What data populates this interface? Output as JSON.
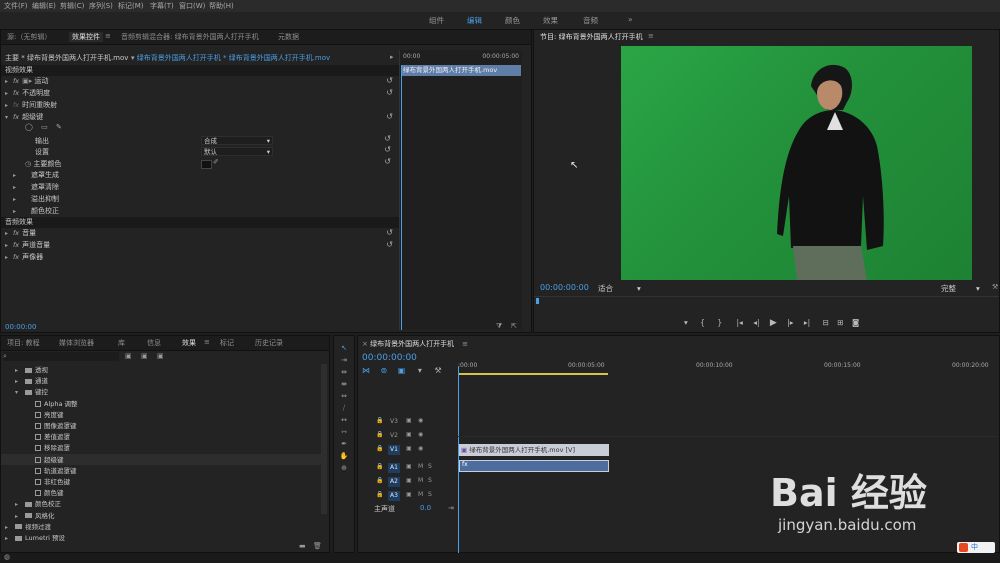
{
  "menubar": [
    "文件(F)",
    "编辑(E)",
    "剪辑(C)",
    "序列(S)",
    "标记(M)",
    "字幕(T)",
    "窗口(W)",
    "帮助(H)"
  ],
  "workspaces": [
    "组件",
    "编辑",
    "颜色",
    "效果",
    "音频",
    "»"
  ],
  "effect_controls": {
    "tabs": [
      "源:（无剪辑）",
      "效果控件",
      "≡",
      "音频剪辑混合器: 绿布背景外国两人打开手机",
      "元数据"
    ],
    "master_label": "主要 * 绿布背景外国两人打开手机.mov",
    "clip_label": "绿布背景外国两人打开手机 * 绿布背景外国两人打开手机.mov",
    "tl_start": "00:00",
    "tl_end": "00:00:05:00",
    "tl_clip": "绿布背景外国两人打开手机.mov",
    "sec_video": "视频效果",
    "rows": [
      "运动",
      "不透明度",
      "时间重映射",
      "超级键"
    ],
    "output_label": "输出",
    "output_value": "合成",
    "settings_label": "设置",
    "settings_value": "默认",
    "key_color_label": "主要颜色",
    "sub_rows": [
      "遮罩生成",
      "遮罩清除",
      "溢出抑制",
      "颜色校正"
    ],
    "sec_audio": "音频效果",
    "audio_rows": [
      "音量",
      "声道音量",
      "声像器"
    ],
    "timecode": "00:00:00"
  },
  "program": {
    "title": "节目: 绿布背景外国两人打开手机",
    "timecode": "00:00:00:00",
    "fit": "适合",
    "quality": "完整"
  },
  "effects_panel": {
    "tabs": [
      "项目: 教程",
      "媒体浏览器",
      "库",
      "信息",
      "效果",
      "≡",
      "标记",
      "历史记录"
    ],
    "items": [
      {
        "label": "透视",
        "type": "folder",
        "indent": 1
      },
      {
        "label": "通道",
        "type": "folder",
        "indent": 1
      },
      {
        "label": "键控",
        "type": "folder",
        "indent": 1
      },
      {
        "label": "Alpha 调整",
        "type": "file",
        "indent": 2
      },
      {
        "label": "亮度键",
        "type": "file",
        "indent": 2
      },
      {
        "label": "图像遮罩键",
        "type": "file",
        "indent": 2
      },
      {
        "label": "差值遮罩",
        "type": "file",
        "indent": 2
      },
      {
        "label": "移除遮罩",
        "type": "file",
        "indent": 2
      },
      {
        "label": "超级键",
        "type": "file",
        "indent": 2
      },
      {
        "label": "轨道遮罩键",
        "type": "file",
        "indent": 2
      },
      {
        "label": "非红色键",
        "type": "file",
        "indent": 2
      },
      {
        "label": "颜色键",
        "type": "file",
        "indent": 2
      },
      {
        "label": "颜色校正",
        "type": "folder",
        "indent": 1
      },
      {
        "label": "风格化",
        "type": "folder",
        "indent": 1
      },
      {
        "label": "视频过渡",
        "type": "folder",
        "indent": 0
      },
      {
        "label": "Lumetri 预设",
        "type": "folder",
        "indent": 0
      }
    ]
  },
  "timeline": {
    "title": "绿布背景外国两人打开手机",
    "timecode": "00:00:00:00",
    "ruler": [
      ":00:00",
      "00:00:05:00",
      "00:00:10:00",
      "00:00:15:00",
      "00:00:20:00"
    ],
    "tracks": [
      {
        "name": "V3",
        "kind": "video"
      },
      {
        "name": "V2",
        "kind": "video"
      },
      {
        "name": "V1",
        "kind": "video"
      },
      {
        "name": "A1",
        "kind": "audio"
      },
      {
        "name": "A2",
        "kind": "audio"
      },
      {
        "name": "A3",
        "kind": "audio"
      }
    ],
    "master": "主声道",
    "master_value": "0.0",
    "video_clip": "绿布背景外国两人打开手机.mov [V]",
    "audio_clip": "fx"
  },
  "watermark": {
    "text": "Bai 经验",
    "url": "jingyan.baidu.com"
  },
  "ime": "中"
}
